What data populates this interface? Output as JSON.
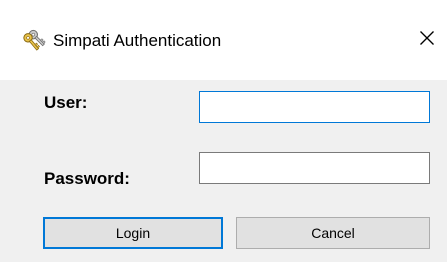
{
  "window": {
    "title": "Simpati Authentication",
    "icon": "keys-icon",
    "close_glyph": "✕"
  },
  "form": {
    "user_label": "User:",
    "user_value": "",
    "password_label": "Password:",
    "password_value": ""
  },
  "buttons": {
    "login_label": "Login",
    "cancel_label": "Cancel"
  },
  "colors": {
    "accent": "#0078d7",
    "dialog_background": "#f0f0f0",
    "button_face": "#e1e1e1"
  }
}
